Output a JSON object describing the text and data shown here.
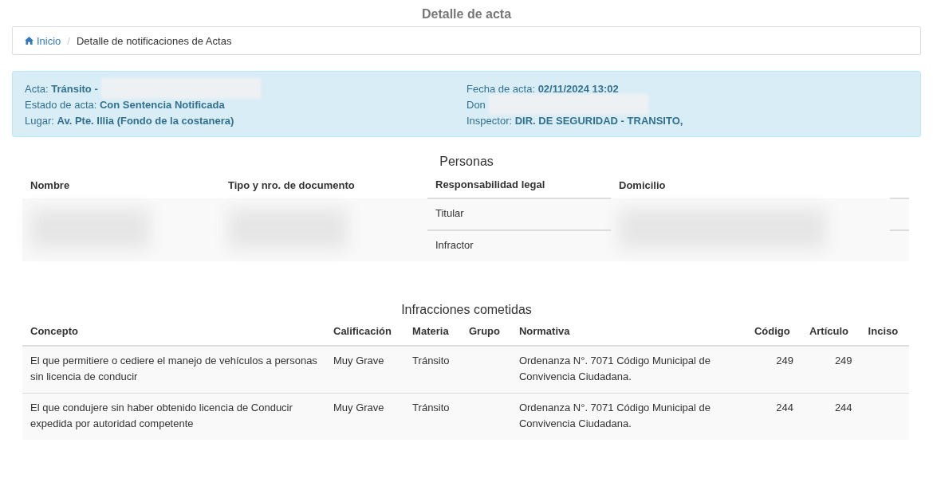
{
  "title": "Detalle de acta",
  "breadcrumb_separator": "/",
  "breadcrumb": [
    {
      "label": "Inicio",
      "link": true
    },
    {
      "label": "Detalle de notificaciones de Actas",
      "link": false
    }
  ],
  "acta": {
    "left": [
      {
        "label": "Acta:",
        "value": "Tránsito -",
        "redacted": true
      },
      {
        "label": "Estado de acta:",
        "value": "Con Sentencia Notificada",
        "redacted": false
      },
      {
        "label": "Lugar:",
        "value": "Av. Pte. Illia (Fondo de la costanera)",
        "redacted": false
      }
    ],
    "right": [
      {
        "label": "Fecha de acta:",
        "value": "02/11/2024 13:02",
        "redacted": false
      },
      {
        "label": "Don",
        "redacted": true
      },
      {
        "label": "Inspector:",
        "value": "DIR. DE SEGURIDAD - TRANSITO,",
        "redacted": false
      }
    ]
  },
  "personas": {
    "heading": "Personas",
    "columns": [
      "Nombre",
      "Tipo y nro. de documento",
      "Responsabilidad legal",
      "Domicilio"
    ],
    "rows": [
      {
        "responsabilidad": "Titular"
      },
      {
        "responsabilidad": "Infractor"
      }
    ]
  },
  "infracciones": {
    "heading": "Infracciones cometidas",
    "columns": [
      "Concepto",
      "Calificación",
      "Materia",
      "Grupo",
      "Normativa",
      "Código",
      "Artículo",
      "Inciso"
    ],
    "rows": [
      {
        "concepto": "El que permitiere o cediere el manejo de vehículos a personas sin licencia de conducir",
        "calificacion": "Muy Grave",
        "materia": "Tránsito",
        "normativa": "Ordenanza N°. 7071 Código Municipal de Convivencia Ciudadana.",
        "codigo": "249",
        "articulo": "249"
      },
      {
        "concepto": "El que condujere sin haber obtenido licencia de Conducir expedida por autoridad competente",
        "calificacion": "Muy Grave",
        "materia": "Tránsito",
        "normativa": "Ordenanza N°. 7071 Código Municipal de Convivencia Ciudadana.",
        "codigo": "244",
        "articulo": "244"
      }
    ]
  }
}
